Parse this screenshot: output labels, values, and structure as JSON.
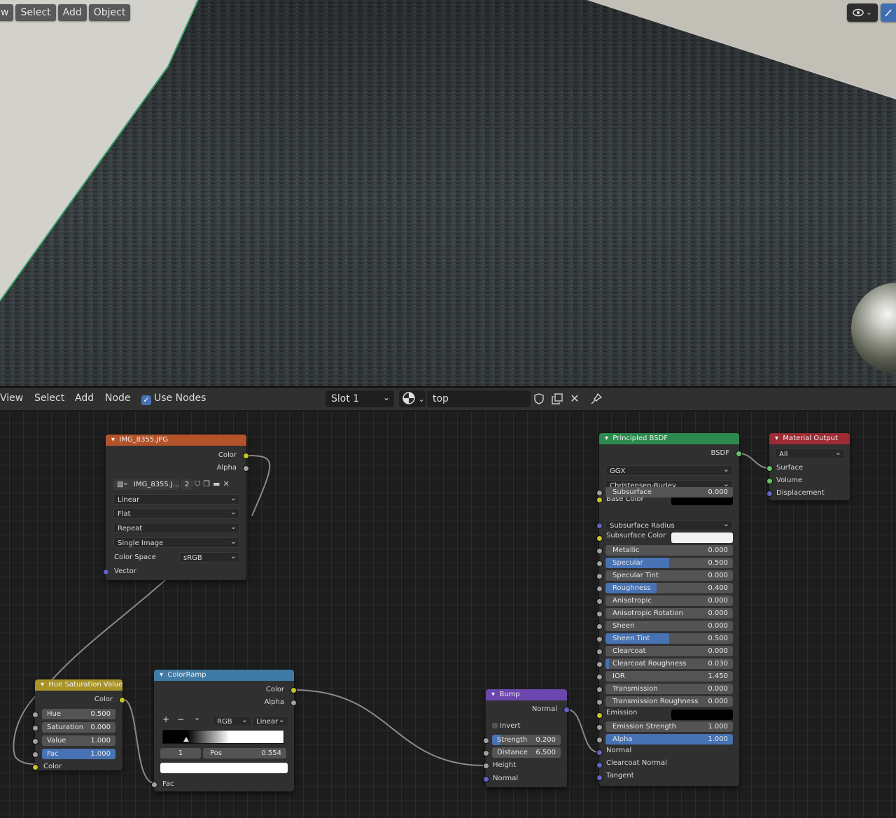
{
  "viewport": {
    "menu": [
      "w",
      "Select",
      "Add",
      "Object"
    ],
    "right_icons": [
      "eye-icon",
      "chevron-down-icon",
      "gizmo-icon"
    ]
  },
  "node_editor_header": {
    "menu": [
      "View",
      "Select",
      "Add",
      "Node"
    ],
    "use_nodes_label": "Use Nodes",
    "use_nodes_checked": true,
    "slot": "Slot 1",
    "material_name": "top",
    "icons": [
      "material-sphere-icon",
      "fake-user-shield-icon",
      "duplicate-icon",
      "close-icon",
      "pin-icon"
    ]
  },
  "nodes": {
    "image": {
      "title": "IMG_8355.JPG",
      "outputs": [
        "Color",
        "Alpha"
      ],
      "image_name": "IMG_8355.J...",
      "users": "2",
      "interpolation": "Linear",
      "projection": "Flat",
      "extension": "Repeat",
      "source": "Single Image",
      "color_space_label": "Color Space",
      "color_space": "sRGB",
      "input": "Vector"
    },
    "hsv": {
      "title": "Hue Saturation Value",
      "output": "Color",
      "fields": [
        {
          "label": "Hue",
          "value": "0.500"
        },
        {
          "label": "Saturation",
          "value": "0.000"
        },
        {
          "label": "Value",
          "value": "1.000"
        },
        {
          "label": "Fac",
          "value": "1.000"
        }
      ],
      "input": "Color"
    },
    "colorramp": {
      "title": "ColorRamp",
      "outputs": [
        "Color",
        "Alpha"
      ],
      "ctrl_plus": "+",
      "ctrl_minus": "−",
      "mode": "RGB",
      "interp": "Linear",
      "index": "1",
      "pos_label": "Pos",
      "pos_value": "0.554",
      "input": "Fac"
    },
    "bump": {
      "title": "Bump",
      "output": "Normal",
      "invert_label": "Invert",
      "fields": [
        {
          "label": "Strength",
          "value": "0.200"
        },
        {
          "label": "Distance",
          "value": "6.500"
        }
      ],
      "inputs": [
        "Height",
        "Normal"
      ]
    },
    "bsdf": {
      "title": "Principled BSDF",
      "output": "BSDF",
      "distribution": "GGX",
      "subsurface_method": "Christensen-Burley",
      "base_color_label": "Base Color",
      "subsurface_radius": "Subsurface Radius",
      "subsurface_color_label": "Subsurface Color",
      "emission_label": "Emission",
      "inputs_bottom": [
        "Normal",
        "Clearcoat Normal",
        "Tangent"
      ],
      "fields": [
        {
          "label": "Subsurface",
          "value": "0.000",
          "fill": 0
        },
        {
          "label": "Metallic",
          "value": "0.000",
          "fill": 0
        },
        {
          "label": "Specular",
          "value": "0.500",
          "fill": 0.5
        },
        {
          "label": "Specular Tint",
          "value": "0.000",
          "fill": 0
        },
        {
          "label": "Roughness",
          "value": "0.400",
          "fill": 0.4
        },
        {
          "label": "Anisotropic",
          "value": "0.000",
          "fill": 0
        },
        {
          "label": "Anisotropic Rotation",
          "value": "0.000",
          "fill": 0
        },
        {
          "label": "Sheen",
          "value": "0.000",
          "fill": 0
        },
        {
          "label": "Sheen Tint",
          "value": "0.500",
          "fill": 0.5
        },
        {
          "label": "Clearcoat",
          "value": "0.000",
          "fill": 0
        },
        {
          "label": "Clearcoat Roughness",
          "value": "0.030",
          "fill": 0.03
        },
        {
          "label": "IOR",
          "value": "1.450",
          "fill": 0
        },
        {
          "label": "Transmission",
          "value": "0.000",
          "fill": 0
        },
        {
          "label": "Transmission Roughness",
          "value": "0.000",
          "fill": 0
        },
        {
          "label": "Emission Strength",
          "value": "1.000",
          "fill": 0
        },
        {
          "label": "Alpha",
          "value": "1.000",
          "fill": 1
        }
      ]
    },
    "output": {
      "title": "Material Output",
      "target": "All",
      "inputs": [
        "Surface",
        "Volume",
        "Displacement"
      ]
    }
  },
  "colors": {
    "image_header": "#b4522a",
    "hsv_header": "#a89328",
    "colorramp_header": "#3f7ba5",
    "bump_header": "#6a46ae",
    "bsdf_header": "#2c8a4f",
    "output_header": "#9c2b34",
    "accent": "#4772b3"
  }
}
